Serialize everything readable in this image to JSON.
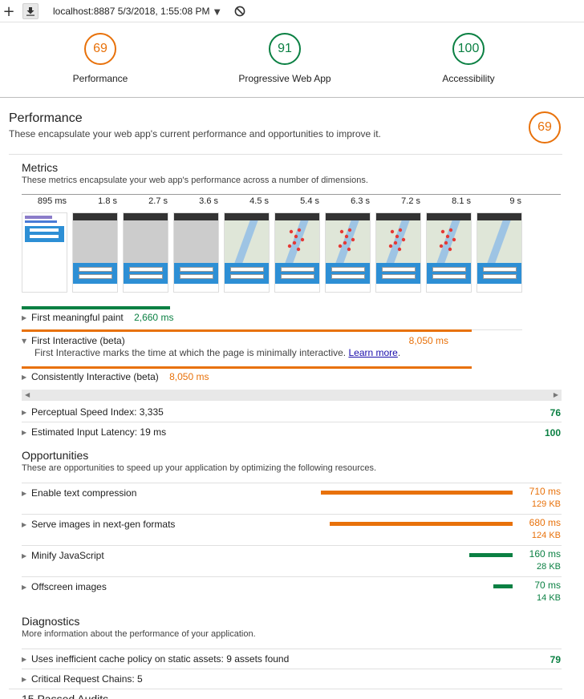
{
  "topbar": {
    "add_icon": "plus-icon",
    "download_icon": "download-icon",
    "report_label": "localhost:8887 5/3/2018, 1:55:08 PM",
    "clear_icon": "no-entry-icon"
  },
  "gauges": [
    {
      "score": "69",
      "label": "Performance",
      "color": "#e8710a"
    },
    {
      "score": "91",
      "label": "Progressive Web App",
      "color": "#0b8043"
    },
    {
      "score": "100",
      "label": "Accessibility",
      "color": "#0b8043"
    }
  ],
  "performance": {
    "title": "Performance",
    "description": "These encapsulate your web app's current performance and opportunities to improve it.",
    "score": "69"
  },
  "metrics": {
    "title": "Metrics",
    "description": "These metrics encapsulate your web app's performance across a number of dimensions.",
    "timeline_ticks": [
      "895 ms",
      "1.8 s",
      "2.7 s",
      "3.6 s",
      "4.5 s",
      "5.4 s",
      "6.3 s",
      "7.2 s",
      "8.1 s",
      "9 s"
    ],
    "frames": [
      "initial",
      "blank",
      "blank",
      "blank",
      "map",
      "map-pins",
      "map-pins",
      "map-pins",
      "map-pins",
      "map"
    ],
    "first_meaningful_paint": {
      "label": "First meaningful paint",
      "value": "2,660 ms",
      "fill": 0.295
    },
    "first_interactive": {
      "label": "First Interactive (beta)",
      "value": "8,050 ms",
      "description": "First Interactive marks the time at which the page is minimally interactive.",
      "link": "Learn more",
      "suffix": ".",
      "fill": 0.899
    },
    "consistently_interactive": {
      "label": "Consistently Interactive (beta)",
      "value": "8,050 ms",
      "fill": 0.899
    },
    "perceptual_speed_index": {
      "label": "Perceptual Speed Index: 3,335",
      "score": "76"
    },
    "estimated_input_latency": {
      "label": "Estimated Input Latency: 19 ms",
      "score": "100"
    }
  },
  "opportunities": {
    "title": "Opportunities",
    "description": "These are opportunities to speed up your application by optimizing the following resources.",
    "items": [
      {
        "label": "Enable text compression",
        "time": "710 ms",
        "size": "129 KB",
        "color": "#e8710a",
        "fill": 1.0
      },
      {
        "label": "Serve images in next-gen formats",
        "time": "680 ms",
        "size": "124 KB",
        "color": "#e8710a",
        "fill": 0.955
      },
      {
        "label": "Minify JavaScript",
        "time": "160 ms",
        "size": "28 KB",
        "color": "#0b8043",
        "fill": 0.226
      },
      {
        "label": "Offscreen images",
        "time": "70 ms",
        "size": "14 KB",
        "color": "#0b8043",
        "fill": 0.1
      }
    ]
  },
  "diagnostics": {
    "title": "Diagnostics",
    "description": "More information about the performance of your application.",
    "items": [
      {
        "label": "Uses inefficient cache policy on static assets: 9 assets found",
        "score": "79"
      },
      {
        "label": "Critical Request Chains: 5",
        "score": ""
      }
    ]
  },
  "passed": {
    "title": "15 Passed Audits"
  }
}
